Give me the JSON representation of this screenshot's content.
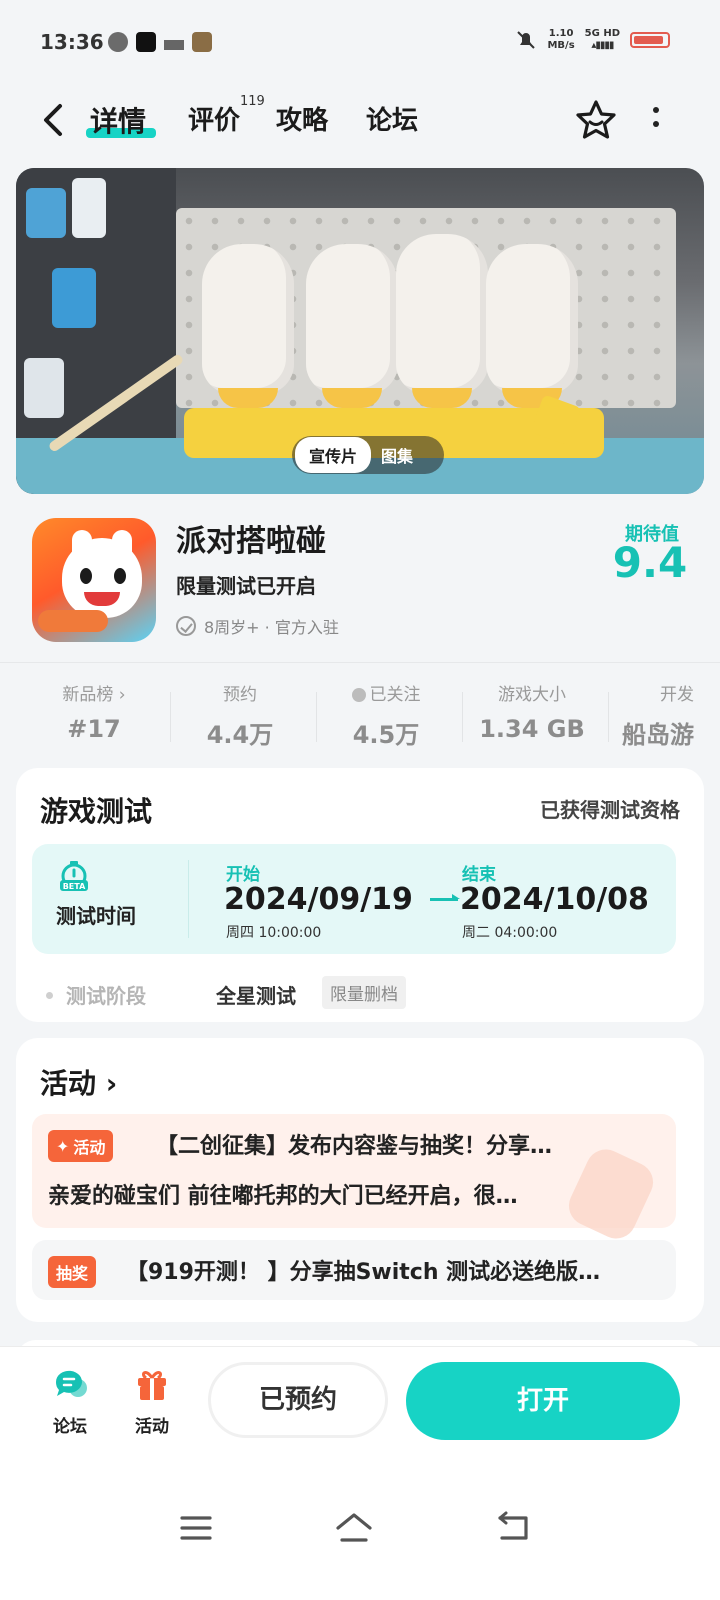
{
  "status": {
    "time": "13:36",
    "net_speed_value": "1.10",
    "net_speed_unit": "MB/s",
    "signal_top": "5G HD",
    "battery_percent": 0.9
  },
  "header": {
    "tabs": [
      "详情",
      "评价",
      "攻略",
      "论坛"
    ],
    "review_count": "119"
  },
  "banner": {
    "toggle_active": "宣传片",
    "toggle_inactive": "图集"
  },
  "app": {
    "name": "派对搭啦碰",
    "subtitle": "限量测试已开启",
    "meta": "8周岁+ · 官方入驻",
    "score_label": "期待值",
    "score_value": "9.4"
  },
  "stats": [
    {
      "label": "新品榜 ›",
      "value": "#17"
    },
    {
      "label": "预约",
      "value": "4.4万"
    },
    {
      "label": "已关注",
      "value": "4.5万"
    },
    {
      "label": "游戏大小",
      "value": "1.34  GB"
    },
    {
      "label": "开发",
      "value": "船岛游"
    }
  ],
  "test_card": {
    "title": "游戏测试",
    "qualification": "已获得测试资格",
    "beta_label": "BETA",
    "time_label": "测试时间",
    "start_label": "开始",
    "start_date": "2024/09/19",
    "start_detail": "周四   10:00:00",
    "end_label": "结束",
    "end_date": "2024/10/08",
    "end_detail": "周二    04:00:00",
    "stage_label": "测试阶段",
    "stage_value": "全星测试",
    "stage_tag": "限量删档"
  },
  "activity_card": {
    "title": "活动 ›",
    "items": [
      {
        "tag": "活动",
        "title": "【二创征集】发布内容鉴与抽奖！分享…",
        "desc": "亲爱的碰宝们 前往嘟托邦的大门已经开启，很…"
      },
      {
        "tag": "抽奖",
        "title": "【919开测！ 】分享抽Switch 测试必送绝版…"
      }
    ]
  },
  "bottom_bar": {
    "forum_label": "论坛",
    "activity_label": "活动",
    "reserved_label": "已预约",
    "open_label": "打开"
  },
  "colors": {
    "accent": "#17d3c5",
    "accent_text": "#17c1b4",
    "activity_tag": "#f5653a"
  }
}
